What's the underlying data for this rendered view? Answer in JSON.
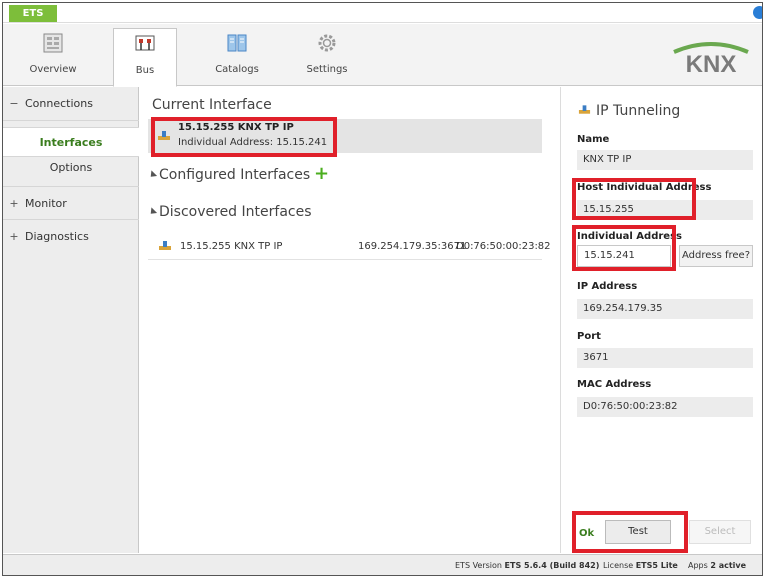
{
  "app": {
    "tab": "ETS"
  },
  "ribbon": {
    "items": [
      {
        "label": "Overview",
        "icon": "overview-icon"
      },
      {
        "label": "Bus",
        "icon": "bus-icon"
      },
      {
        "label": "Catalogs",
        "icon": "catalogs-icon"
      },
      {
        "label": "Settings",
        "icon": "settings-gear-icon"
      }
    ],
    "active": "Bus",
    "logo_text": "KNX"
  },
  "sidebar": {
    "connections": "Connections",
    "interfaces": "Interfaces",
    "options": "Options",
    "monitor": "Monitor",
    "diagnostics": "Diagnostics",
    "minus": "−",
    "plus": "+"
  },
  "main": {
    "current_title": "Current Interface",
    "current_name": "15.15.255 KNX TP IP",
    "current_addr": "Individual Address: 15.15.241",
    "configured_title": "Configured Interfaces",
    "configured_add": "+",
    "discovered_title": "Discovered Interfaces",
    "discovered": [
      {
        "name": "15.15.255 KNX TP IP",
        "ip": "169.254.179.35:3671",
        "mac": "D0:76:50:00:23:82"
      }
    ]
  },
  "panel": {
    "title": "IP Tunneling",
    "name_label": "Name",
    "name_value": "KNX TP IP",
    "host_label": "Host Individual Address",
    "host_value": "15.15.255",
    "ind_label": "Individual Address",
    "ind_value": "15.15.241",
    "addr_free": "Address free?",
    "ip_label": "IP Address",
    "ip_value": "169.254.179.35",
    "port_label": "Port",
    "port_value": "3671",
    "mac_label": "MAC Address",
    "mac_value": "D0:76:50:00:23:82",
    "ok": "Ok",
    "test": "Test",
    "select": "Select"
  },
  "status": {
    "version_label": "ETS Version",
    "version_value": "ETS 5.6.4 (Build 842)",
    "license_label": "License",
    "license_value": "ETS5 Lite",
    "apps_label": "Apps",
    "apps_value": "2 active"
  },
  "colors": {
    "accent_green": "#7dbe3a",
    "highlight_red": "#e0202a",
    "knx_green": "#6aa84f"
  }
}
